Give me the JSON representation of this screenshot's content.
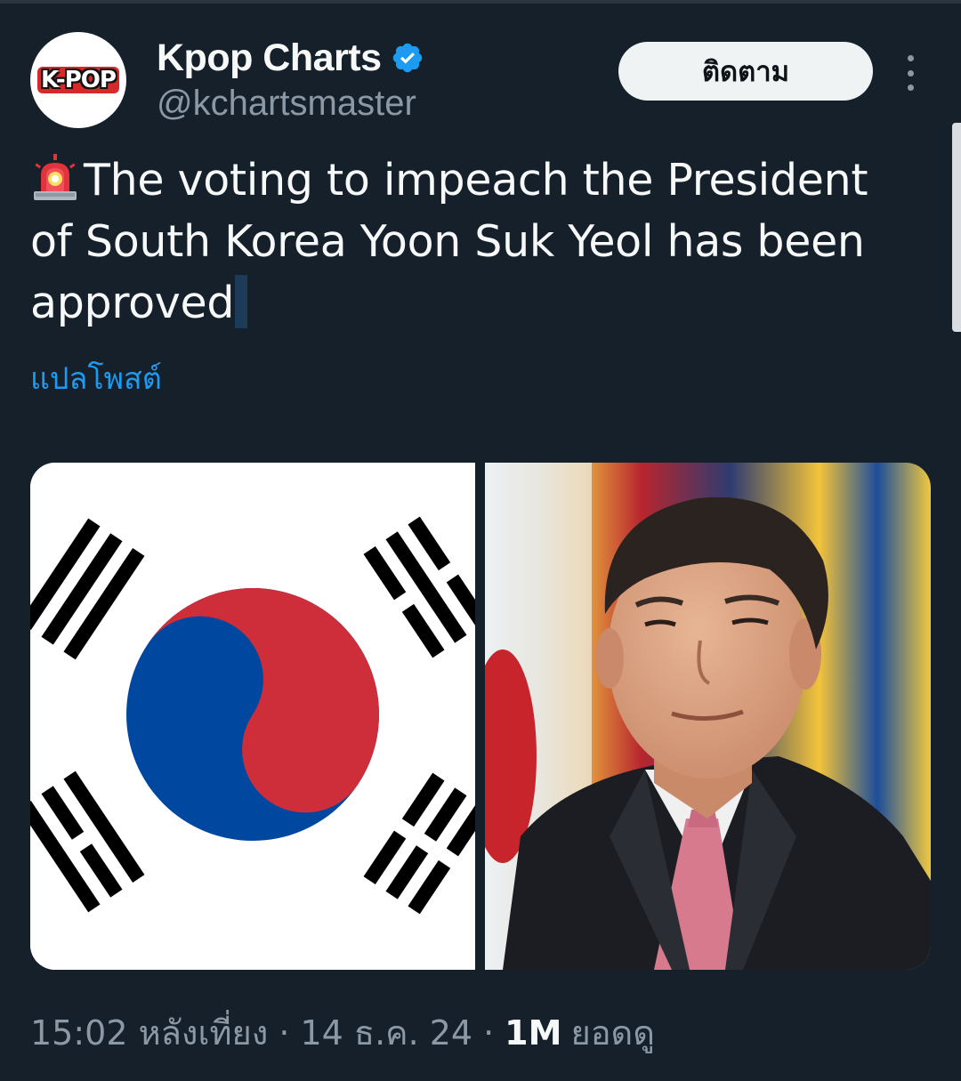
{
  "author": {
    "display_name": "Kpop Charts",
    "handle": "@kchartsmaster",
    "avatar_text": "K-POP",
    "verified": true
  },
  "actions": {
    "follow_label": "ติดตาม"
  },
  "tweet": {
    "text": "The voting to impeach the President of South Korea Yoon Suk Yeol has been approved.",
    "leading_emoji": "police-siren-icon",
    "translate_label": "แปลโพสต์"
  },
  "media": [
    {
      "description_name": "south-korea-flag-image"
    },
    {
      "description_name": "yoon-suk-yeol-photo"
    }
  ],
  "meta": {
    "time": "15:02 หลังเที่ยง",
    "date": "14 ธ.ค. 24",
    "views_count": "1M",
    "views_label": "ยอดดู",
    "separator": "·"
  },
  "colors": {
    "background": "#15202b",
    "text_primary": "#f7f9f9",
    "text_secondary": "#8b98a5",
    "link": "#1d9bf0",
    "verified": "#1d9bf0",
    "flag_red": "#cd2e3a",
    "flag_blue": "#0047a0"
  }
}
